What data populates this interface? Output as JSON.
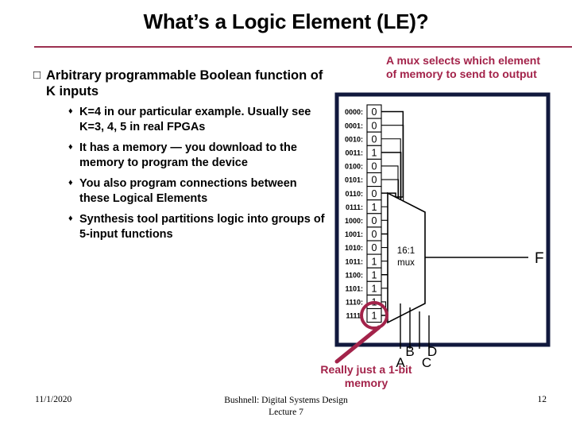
{
  "slide": {
    "title": "What’s a Logic Element (LE)?",
    "rule_color": "#9c3050",
    "accent_color": "#a3234a",
    "figure_border_color": "#11193d"
  },
  "bullets": {
    "level1": {
      "marker": "□",
      "text": "Arbitrary programmable Boolean function of K inputs"
    },
    "level2_marker": "♦",
    "level2": [
      {
        "text": "K=4 in our particular example. Usually see K=3, 4, 5 in real FPGAs"
      },
      {
        "text": "It has a memory — you download to the memory to program the device"
      },
      {
        "text": "You also program connections between these Logical Elements"
      },
      {
        "text": "Synthesis tool partitions logic into groups of 5-input functions"
      }
    ]
  },
  "callouts": {
    "top": "A mux selects which element of memory to send to output",
    "bottom": "Really just a 1-bit memory"
  },
  "figure": {
    "mux_label_line1": "16:1",
    "mux_label_line2": "mux",
    "output_label": "F",
    "select_labels": [
      "A",
      "B",
      "C",
      "D"
    ],
    "address_suffix": ":",
    "rows": [
      {
        "address": "0000",
        "value": "0"
      },
      {
        "address": "0001",
        "value": "0"
      },
      {
        "address": "0010",
        "value": "0"
      },
      {
        "address": "0011",
        "value": "1"
      },
      {
        "address": "0100",
        "value": "0"
      },
      {
        "address": "0101",
        "value": "0"
      },
      {
        "address": "0110",
        "value": "0"
      },
      {
        "address": "0111",
        "value": "1"
      },
      {
        "address": "1000",
        "value": "0"
      },
      {
        "address": "1001",
        "value": "0"
      },
      {
        "address": "1010",
        "value": "0"
      },
      {
        "address": "1011",
        "value": "1"
      },
      {
        "address": "1100",
        "value": "1"
      },
      {
        "address": "1101",
        "value": "1"
      },
      {
        "address": "1110",
        "value": "1"
      },
      {
        "address": "1111",
        "value": "1"
      }
    ],
    "highlighted_row_index": 15
  },
  "footer": {
    "date": "11/1/2020",
    "center_line1": "Bushnell: Digital Systems Design",
    "center_line2": "Lecture 7",
    "page": "12"
  }
}
